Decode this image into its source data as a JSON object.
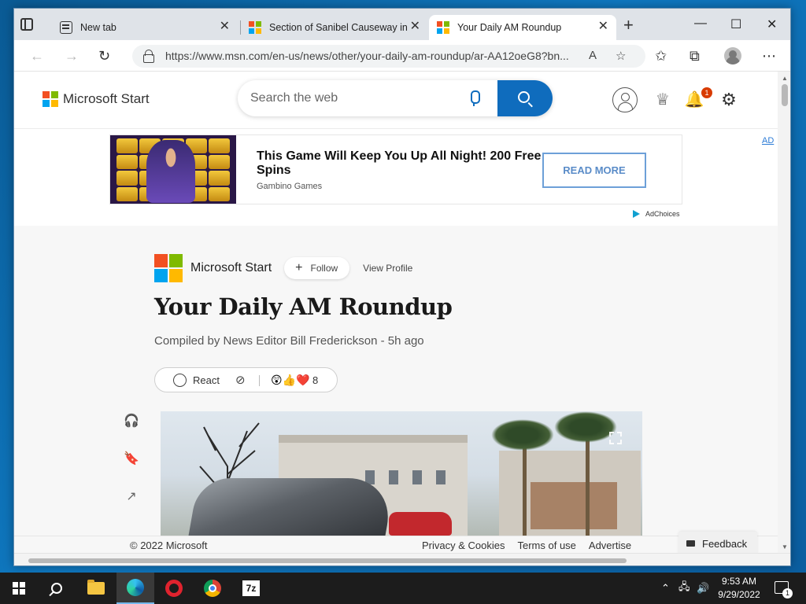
{
  "browser": {
    "tabs": [
      {
        "title": "New tab",
        "close": "✕"
      },
      {
        "title": "Section of Sanibel Causeway in F",
        "close": "✕"
      },
      {
        "title": "Your Daily AM Roundup",
        "close": "✕"
      }
    ],
    "new_tab": "+",
    "window_controls": {
      "minimize": "—",
      "maximize": "☐",
      "close": "✕"
    },
    "toolbar": {
      "back": "←",
      "forward": "→",
      "refresh": "↻",
      "url": "https://www.msn.com/en-us/news/other/your-daily-am-roundup/ar-AA12oeG8?bn...",
      "read_aloud": "A",
      "add_favorite": "☆",
      "favorites": "✩",
      "collections": "⧉",
      "more": "⋯"
    }
  },
  "site": {
    "brand": "Microsoft Start",
    "search_placeholder": "Search the web",
    "notifications_count": "1",
    "reward": "♕",
    "bell": "🔔",
    "gear": "⚙"
  },
  "ad": {
    "headline": "This Game Will Keep You Up All Night! 200 Free Spins",
    "sponsor": "Gambino Games",
    "cta": "READ MORE",
    "ad_mark": "AD",
    "adchoices": "AdChoices"
  },
  "article": {
    "publisher": "Microsoft Start",
    "follow_label": "Follow",
    "follow_plus": "+",
    "view_profile": "View Profile",
    "title": "Your Daily AM Roundup",
    "byline": "Compiled by News Editor Bill Frederickson - 5h ago",
    "react_label": "React",
    "comments_off": "⊘",
    "emojis": "😲👍❤️",
    "reaction_count": "8",
    "side_tools": {
      "listen": "🎧",
      "save": "🔖",
      "share": "↗"
    }
  },
  "footer": {
    "copyright": "© 2022 Microsoft",
    "links": [
      "Privacy & Cookies",
      "Terms of use",
      "Advertise"
    ],
    "feedback": "Feedback"
  },
  "taskbar": {
    "apps": [
      "Start",
      "Search",
      "File Explorer",
      "Microsoft Edge",
      "Opera",
      "Google Chrome",
      "7-Zip"
    ],
    "z7": "7z",
    "time": "9:53 AM",
    "date": "9/29/2022",
    "notifications": "1",
    "tray_chevron": "⌃",
    "tray_network": "🖧",
    "tray_volume": "🔊"
  },
  "colors": {
    "accent": "#0f6cbd",
    "badge": "#d83b01",
    "desktop": "#0f78c0"
  }
}
